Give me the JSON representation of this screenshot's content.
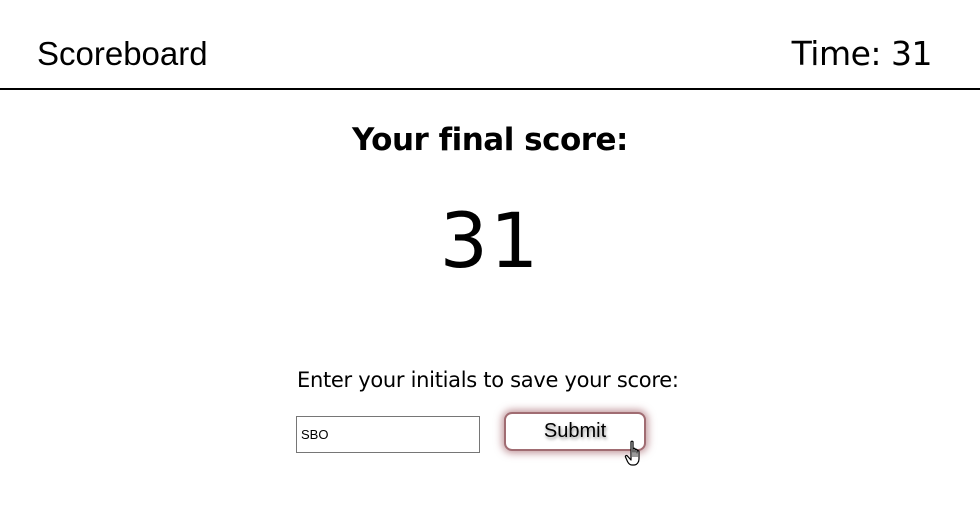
{
  "header": {
    "scoreboard_label": "Scoreboard",
    "timer_text": "Time: 31"
  },
  "main": {
    "heading": "Your final score:",
    "score": "31",
    "prompt": "Enter your initials to save your score:",
    "initials_value": "SBO",
    "submit_label": "Submit"
  },
  "icons": {
    "cursor": "hand-pointer-icon"
  },
  "colors": {
    "header_border": "#000000",
    "button_border": "#a06c72",
    "button_glow": "#8c3c46"
  }
}
